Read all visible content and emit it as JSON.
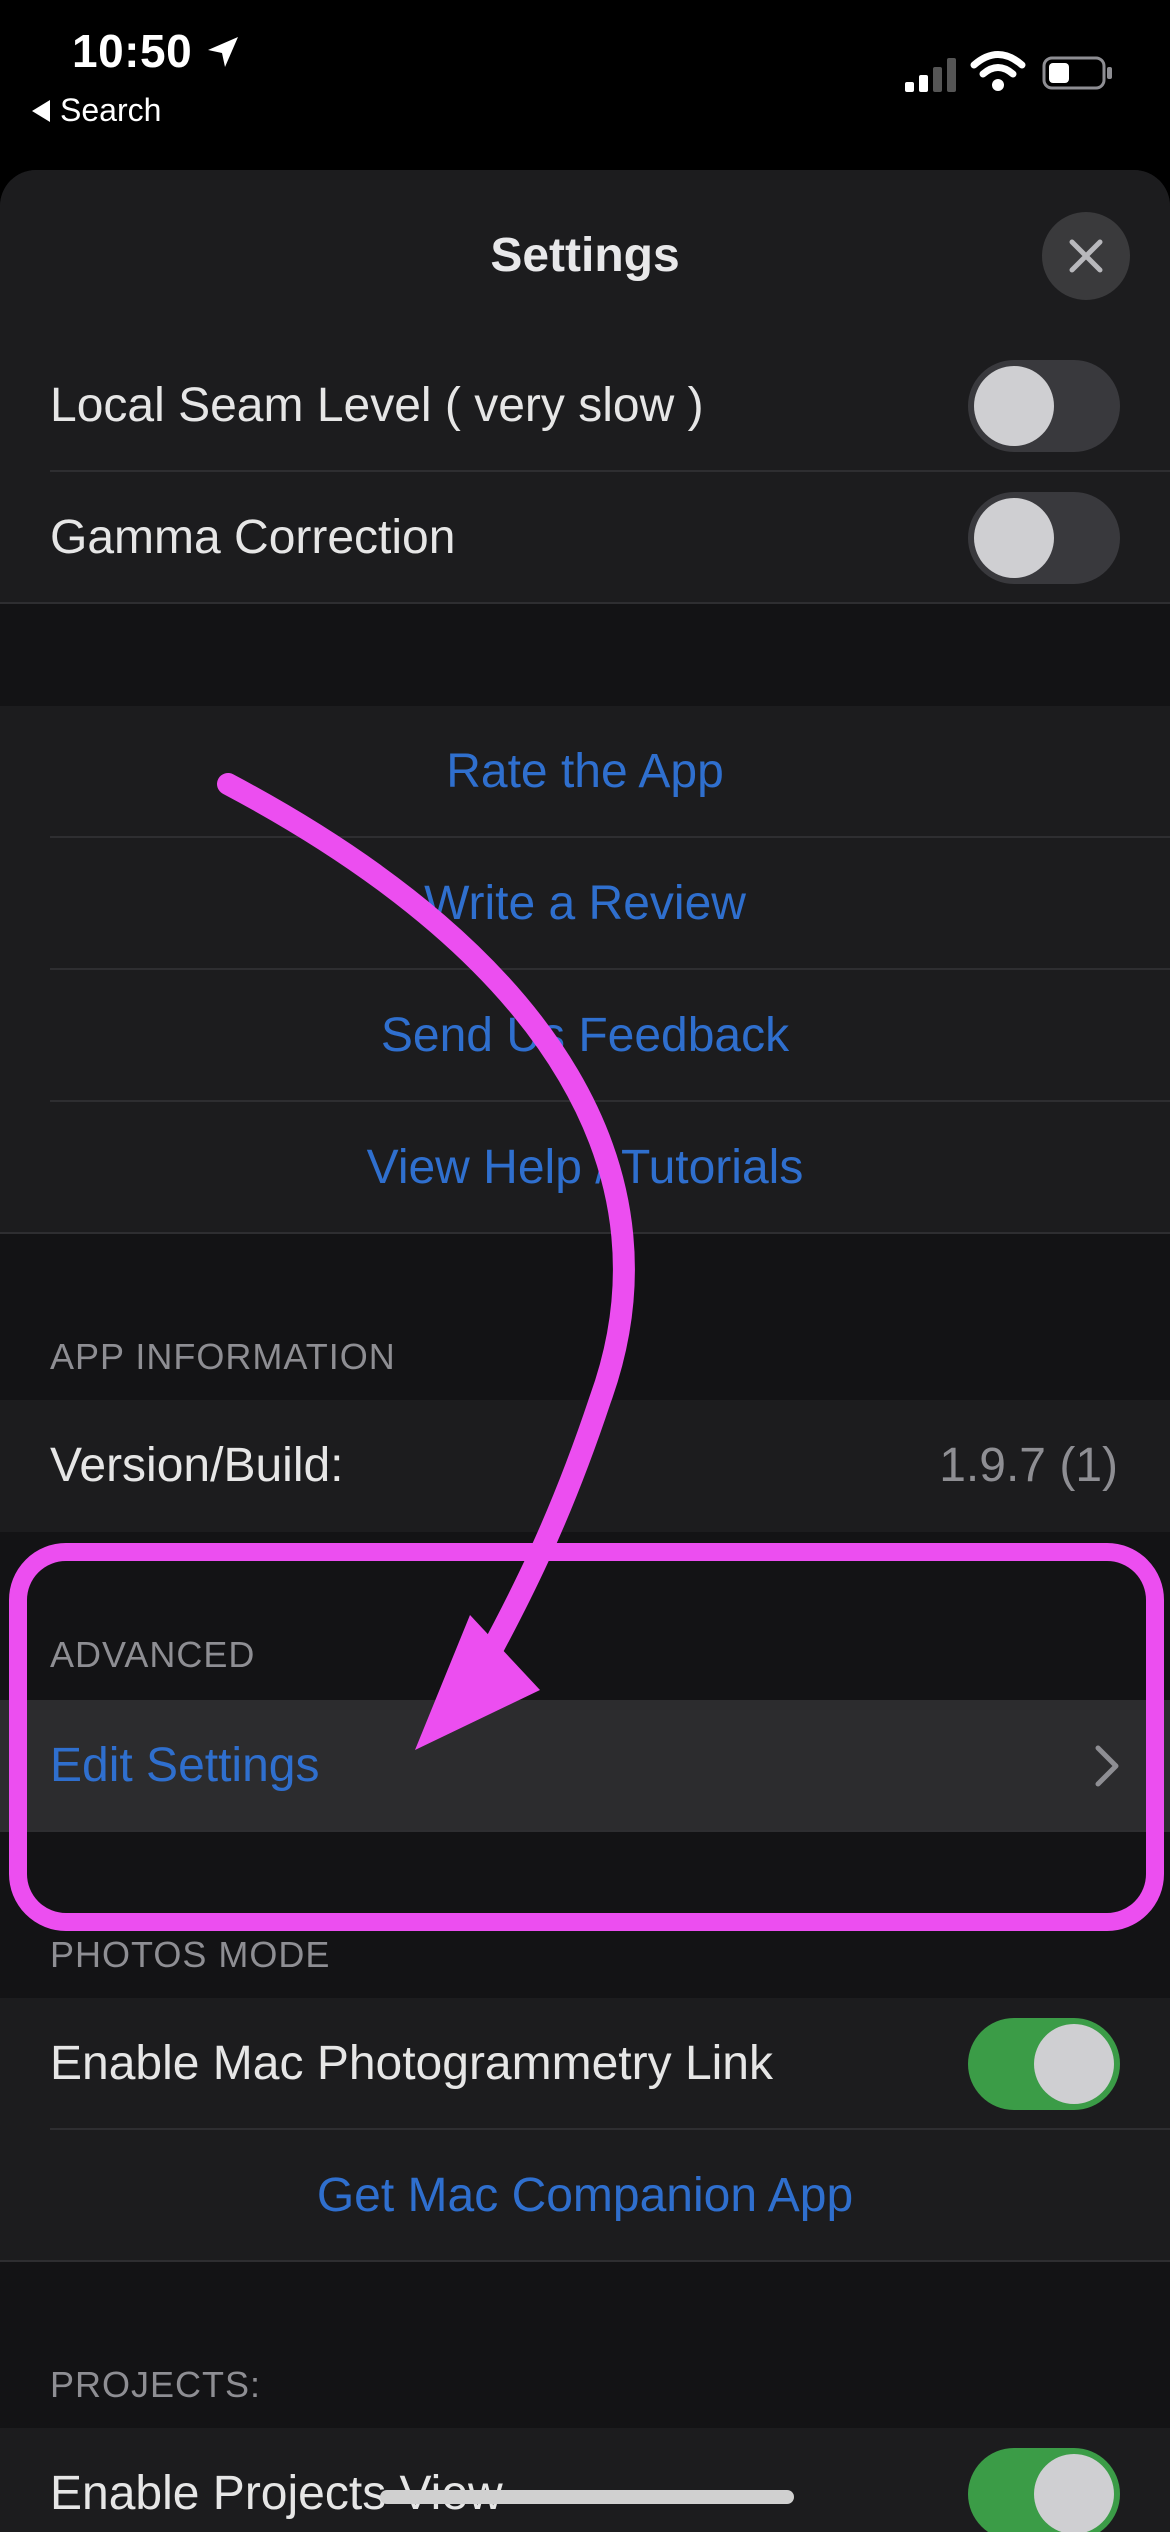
{
  "status_bar": {
    "time": "10:50",
    "back_label": "Search"
  },
  "sheet": {
    "title": "Settings"
  },
  "toggles": [
    {
      "label": "Local Seam Level ( very slow )",
      "on": false
    },
    {
      "label": "Gamma Correction",
      "on": false
    }
  ],
  "links": {
    "rate": "Rate the App",
    "review": "Write a Review",
    "feedback": "Send Us Feedback",
    "help": "View Help / Tutorials"
  },
  "app_information": {
    "header": "APP INFORMATION",
    "version_label": "Version/Build:",
    "version_value": "1.9.7 (1)"
  },
  "advanced": {
    "header": "ADVANCED",
    "edit_settings": "Edit Settings"
  },
  "photos_mode": {
    "header": "PHOTOS MODE",
    "mac_link_label": "Enable Mac Photogrammetry Link",
    "mac_link_on": true,
    "companion_app": "Get Mac Companion App"
  },
  "projects": {
    "header": "PROJECTS:",
    "projects_view_label": "Enable Projects View",
    "projects_view_on": true
  },
  "colors": {
    "link_blue": "#2f6fce",
    "annotation_magenta": "#ec4ef0",
    "toggle_on_green": "#3b9c47"
  }
}
